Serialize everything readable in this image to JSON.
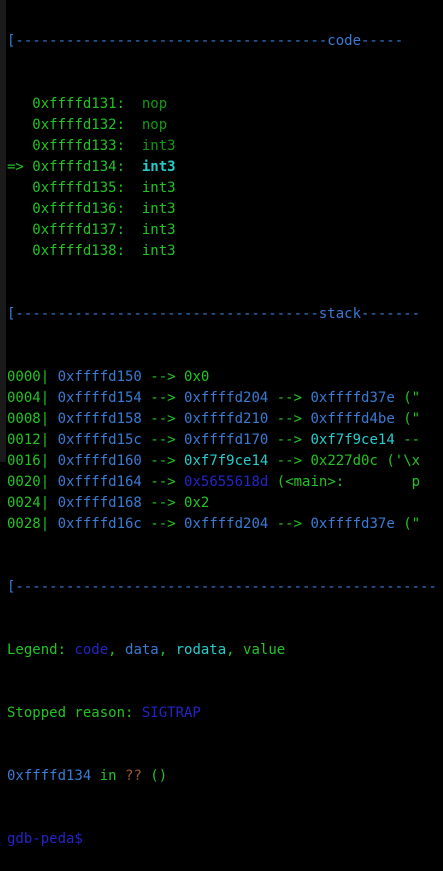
{
  "header_code": "[-------------------------------------code-----",
  "code": [
    {
      "marker": "   ",
      "addr": "0xffffd131:",
      "instr": "nop",
      "state": "past"
    },
    {
      "marker": "   ",
      "addr": "0xffffd132:",
      "instr": "nop",
      "state": "past"
    },
    {
      "marker": "   ",
      "addr": "0xffffd133:",
      "instr": "int3",
      "state": "past"
    },
    {
      "marker": "=> ",
      "addr": "0xffffd134:",
      "instr": "int3",
      "state": "current"
    },
    {
      "marker": "   ",
      "addr": "0xffffd135:",
      "instr": "int3",
      "state": "next"
    },
    {
      "marker": "   ",
      "addr": "0xffffd136:",
      "instr": "int3",
      "state": "next"
    },
    {
      "marker": "   ",
      "addr": "0xffffd137:",
      "instr": "int3",
      "state": "next"
    },
    {
      "marker": "   ",
      "addr": "0xffffd138:",
      "instr": "int3",
      "state": "next"
    }
  ],
  "header_stack": "[------------------------------------stack-------",
  "stack": [
    {
      "off": "0000",
      "addr": "0xffffd150",
      "chain": [
        {
          "t": "0x0",
          "c": "g"
        }
      ]
    },
    {
      "off": "0004",
      "addr": "0xffffd154",
      "chain": [
        {
          "t": "0xffffd204",
          "c": "b"
        },
        {
          "t": "0xffffd37e",
          "c": "b"
        },
        {
          "t": "(\"",
          "c": "g",
          "plain": true
        }
      ]
    },
    {
      "off": "0008",
      "addr": "0xffffd158",
      "chain": [
        {
          "t": "0xffffd210",
          "c": "b"
        },
        {
          "t": "0xffffd4be",
          "c": "b"
        },
        {
          "t": "(\"",
          "c": "g",
          "plain": true
        }
      ]
    },
    {
      "off": "0012",
      "addr": "0xffffd15c",
      "chain": [
        {
          "t": "0xffffd170",
          "c": "b"
        },
        {
          "t": "0xf7f9ce14",
          "c": "c"
        },
        {
          "t": "--",
          "c": "g",
          "plain": true
        }
      ]
    },
    {
      "off": "0016",
      "addr": "0xffffd160",
      "chain": [
        {
          "t": "0xf7f9ce14",
          "c": "c"
        },
        {
          "t": "0x227d0c",
          "c": "g"
        },
        {
          "t": "('\\x",
          "c": "g",
          "plain": true
        }
      ]
    },
    {
      "off": "0020",
      "addr": "0xffffd164",
      "chain": [
        {
          "t": "0x5655618d",
          "c": "db"
        },
        {
          "t": "(<main>:        p",
          "c": "g",
          "plain": true
        }
      ]
    },
    {
      "off": "0024",
      "addr": "0xffffd168",
      "chain": [
        {
          "t": "0x2",
          "c": "g"
        }
      ]
    },
    {
      "off": "0028",
      "addr": "0xffffd16c",
      "chain": [
        {
          "t": "0xffffd204",
          "c": "b"
        },
        {
          "t": "0xffffd37e",
          "c": "b"
        },
        {
          "t": "(\"",
          "c": "g",
          "plain": true
        }
      ]
    }
  ],
  "divider": "[--------------------------------------------------",
  "legend": {
    "label": "Legend: ",
    "code": "code",
    "data": "data",
    "rodata": "rodata",
    "value": "value",
    "sep": ", "
  },
  "stopped": {
    "label": "Stopped reason: ",
    "reason": "SIGTRAP"
  },
  "location": {
    "addr": "0xffffd134",
    "in": " in ",
    "func": "??",
    "args": " ()"
  },
  "prompt": "gdb-peda$ ",
  "colors": {
    "green": "#22c422",
    "blue": "#3a7bd5",
    "cyan": "#26cdcd",
    "darkblue": "#2424c8"
  }
}
